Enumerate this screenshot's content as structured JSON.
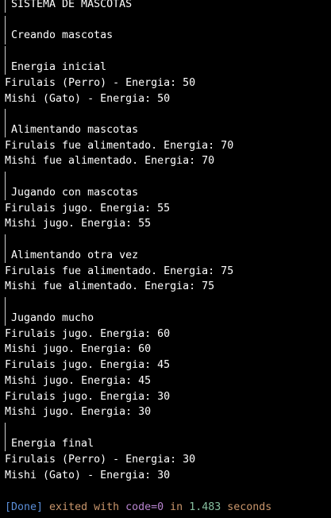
{
  "output": {
    "lines": [
      {
        "text": "SISTEMA DE MASCOTAS",
        "section": true
      },
      {
        "text": "Creando mascotas",
        "section": true
      },
      {
        "text": "Energia inicial",
        "section": true
      },
      {
        "text": "Firulais (Perro) - Energia: 50",
        "section": false
      },
      {
        "text": "Mishi (Gato) - Energia: 50",
        "section": false
      },
      {
        "text": "Alimentando mascotas",
        "section": true
      },
      {
        "text": "Firulais fue alimentado. Energia: 70",
        "section": false
      },
      {
        "text": "Mishi fue alimentado. Energia: 70",
        "section": false
      },
      {
        "text": "Jugando con mascotas",
        "section": true
      },
      {
        "text": "Firulais jugo. Energia: 55",
        "section": false
      },
      {
        "text": "Mishi jugo. Energia: 55",
        "section": false
      },
      {
        "text": "Alimentando otra vez",
        "section": true
      },
      {
        "text": "Firulais fue alimentado. Energia: 75",
        "section": false
      },
      {
        "text": "Mishi fue alimentado. Energia: 75",
        "section": false
      },
      {
        "text": "Jugando mucho",
        "section": true
      },
      {
        "text": "Firulais jugo. Energia: 60",
        "section": false
      },
      {
        "text": "Mishi jugo. Energia: 60",
        "section": false
      },
      {
        "text": "Firulais jugo. Energia: 45",
        "section": false
      },
      {
        "text": "Mishi jugo. Energia: 45",
        "section": false
      },
      {
        "text": "Firulais jugo. Energia: 30",
        "section": false
      },
      {
        "text": "Mishi jugo. Energia: 30",
        "section": false
      },
      {
        "text": "Energia final",
        "section": true
      },
      {
        "text": "Firulais (Perro) - Energia: 30",
        "section": false
      },
      {
        "text": "Mishi (Gato) - Energia: 30",
        "section": false
      }
    ]
  },
  "status": {
    "done_label": "[Done]",
    "exited_text": " exited with ",
    "code_text": "code=0",
    "in_text": " in ",
    "duration": "1.483",
    "seconds_text": " seconds"
  },
  "colors": {
    "background": "#000000",
    "text": "#ffffff",
    "done": "#5b8fd9",
    "status_text": "#c8956b",
    "code": "#b884d0",
    "number": "#87c0a0"
  }
}
